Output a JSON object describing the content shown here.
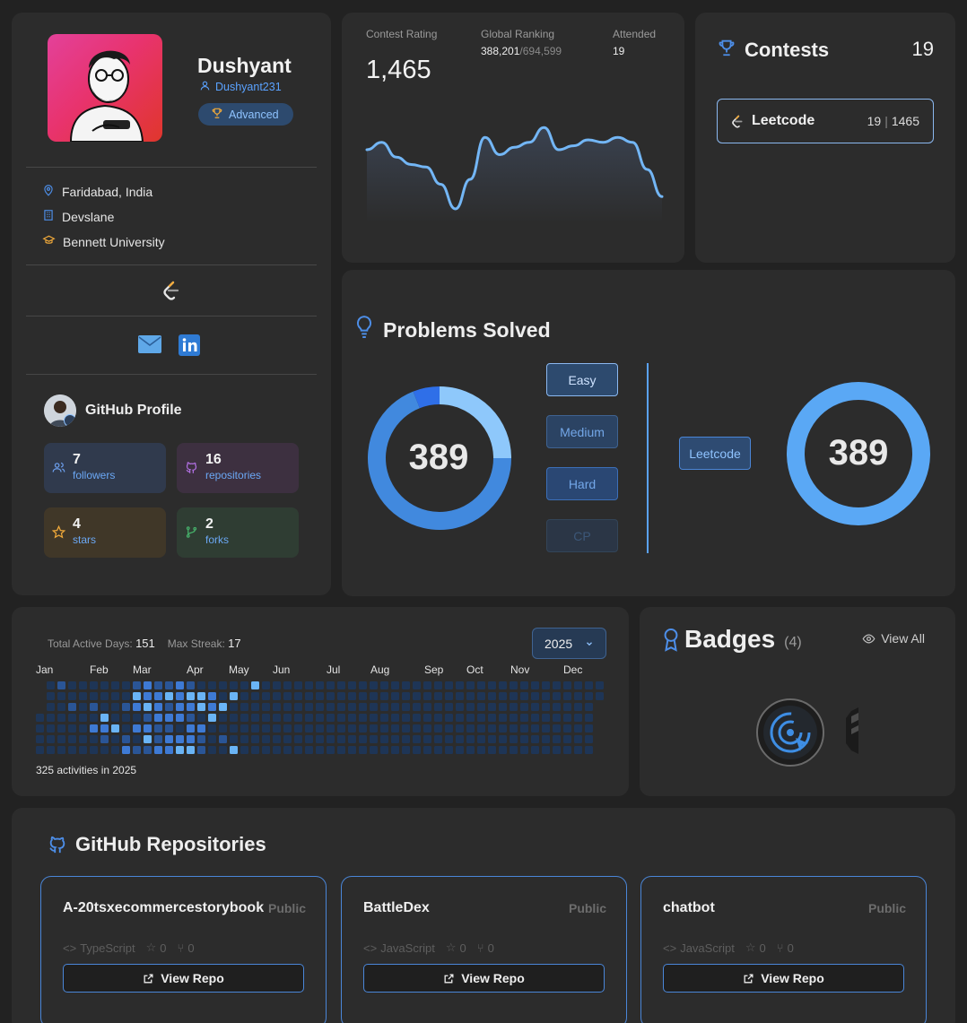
{
  "profile": {
    "name": "Dushyant",
    "username": "Dushyant231",
    "level": "Advanced",
    "location": "Faridabad, India",
    "company": "Devslane",
    "education": "Bennett University",
    "github": {
      "title": "GitHub Profile",
      "followers": {
        "value": "7",
        "label": "followers"
      },
      "repositories": {
        "value": "16",
        "label": "repositories"
      },
      "stars": {
        "value": "4",
        "label": "stars"
      },
      "forks": {
        "value": "2",
        "label": "forks"
      }
    }
  },
  "rating": {
    "contest_rating_label": "Contest Rating",
    "contest_rating": "1,465",
    "global_ranking_label": "Global Ranking",
    "global_rank": "388,201",
    "global_total": "/694,599",
    "attended_label": "Attended",
    "attended": "19"
  },
  "chart_data": {
    "type": "area",
    "title": "",
    "xlabel": "",
    "ylabel": "",
    "series": [
      {
        "values": [
          1540,
          1555,
          1525,
          1510,
          1505,
          1470,
          1420,
          1480,
          1565,
          1530,
          1545,
          1555,
          1585,
          1540,
          1548,
          1560,
          1555,
          1565,
          1555,
          1500,
          1445
        ]
      }
    ]
  },
  "contests": {
    "title": "Contests",
    "count": "19",
    "platform": {
      "name": "Leetcode",
      "attended": "19",
      "rating": "1465"
    }
  },
  "problems": {
    "title": "Problems Solved",
    "total": "389",
    "difficulty": [
      "Easy",
      "Medium",
      "Hard",
      "CP"
    ],
    "platform_label": "Leetcode",
    "platform_total": "389",
    "breakdown_fractions": {
      "easy": 0.25,
      "medium": 0.69,
      "hard": 0.06
    }
  },
  "activity": {
    "total_active_label": "Total Active Days:",
    "total_active": "151",
    "max_streak_label": "Max Streak:",
    "max_streak": "17",
    "year": "2025",
    "months": [
      "Jan",
      "Feb",
      "Mar",
      "Apr",
      "May",
      "Jun",
      "Jul",
      "Aug",
      "Sep",
      "Oct",
      "Nov",
      "Dec"
    ],
    "footer": "325 activities in 2025"
  },
  "badges": {
    "title": "Badges",
    "count": "(4)",
    "view_all": "View All"
  },
  "repos": {
    "title": "GitHub Repositories",
    "items": [
      {
        "name": "A-20tsxecommercestorybook",
        "visibility": "Public",
        "language": "TypeScript",
        "stars": "0",
        "forks": "0",
        "button": "View Repo"
      },
      {
        "name": "BattleDex",
        "visibility": "Public",
        "language": "JavaScript",
        "stars": "0",
        "forks": "0",
        "button": "View Repo"
      },
      {
        "name": "chatbot",
        "visibility": "Public",
        "language": "JavaScript",
        "stars": "0",
        "forks": "0",
        "button": "View Repo"
      }
    ]
  },
  "colors": {
    "accent": "#5aa2ff",
    "card": "#2c2c2c",
    "background": "#222222",
    "easy": "#8ec8fb",
    "medium": "#4189de",
    "hard": "#2f6fe8",
    "leetcode_ring": "#5aa8f5"
  },
  "icons": [
    "user-icon",
    "trophy-icon",
    "location-pin-icon",
    "building-icon",
    "graduation-cap-icon",
    "leetcode-logo-icon",
    "mail-icon",
    "linkedin-icon",
    "github-icon",
    "followers-icon",
    "repo-icon",
    "star-icon",
    "fork-icon",
    "bulb-icon",
    "chevron-down-icon",
    "award-icon",
    "eye-icon",
    "code-icon",
    "external-link-icon"
  ]
}
